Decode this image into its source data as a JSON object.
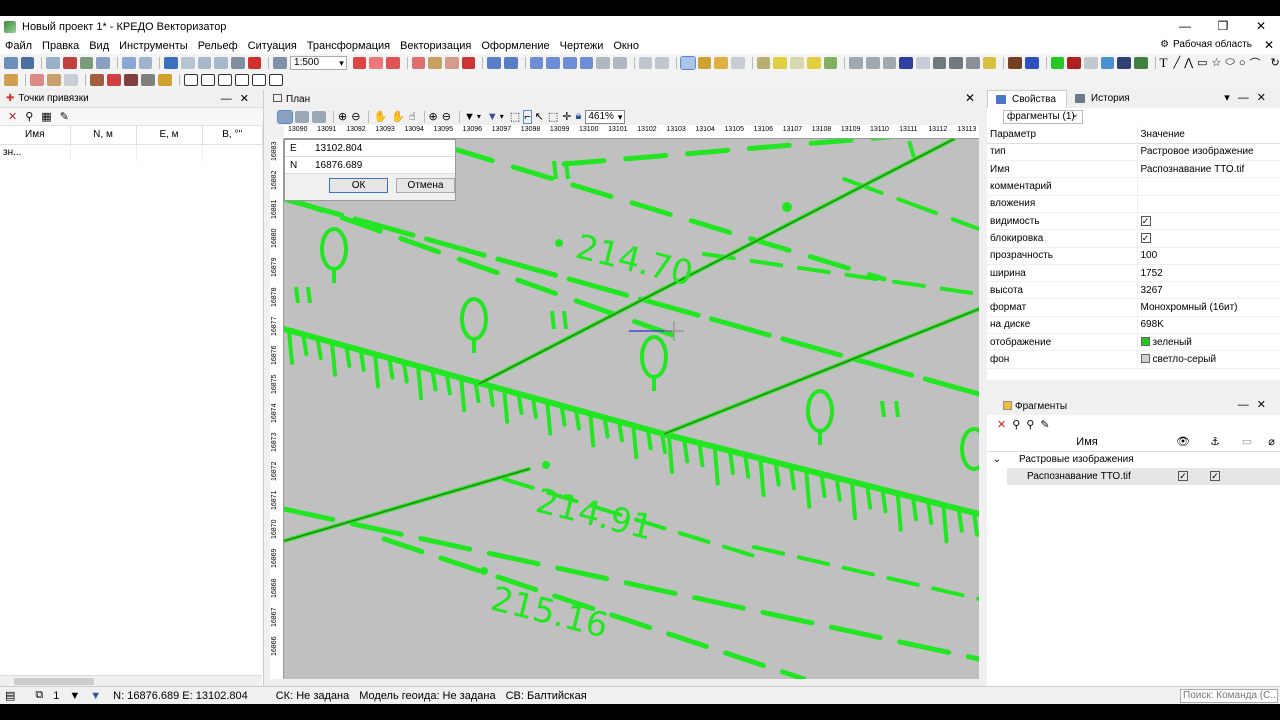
{
  "window": {
    "title": "Новый проект 1* - КРЕДО Векторизатор",
    "min_icon": "—",
    "max_icon": "❐",
    "close_icon": "✕"
  },
  "menu": [
    "Файл",
    "Правка",
    "Вид",
    "Инструменты",
    "Рельеф",
    "Ситуация",
    "Трансформация",
    "Векторизация",
    "Оформление",
    "Чертежи",
    "Окно"
  ],
  "workspace_label": "Рабочая область",
  "toolbar": {
    "scale_value": "1:500"
  },
  "left_panel": {
    "title": "Точки привязки",
    "columns": [
      "Имя",
      "N, м",
      "E, м",
      "B, °''"
    ],
    "rows": [
      {
        "name": "зн..."
      }
    ]
  },
  "plan": {
    "title": "План",
    "zoom": "461%",
    "ruler_x": [
      "13090",
      "13091",
      "13092",
      "13093",
      "13094",
      "13095",
      "13096",
      "13097",
      "13098",
      "13099",
      "13100",
      "13101",
      "13102",
      "13103",
      "13104",
      "13105",
      "13106",
      "13107",
      "13108",
      "13109",
      "13110",
      "13111",
      "13112",
      "13113"
    ],
    "ruler_y": [
      "16883",
      "16882",
      "16881",
      "16880",
      "16879",
      "16878",
      "16877",
      "16876",
      "16875",
      "16874",
      "16873",
      "16872",
      "16871",
      "16870",
      "16869",
      "16868",
      "16867",
      "16866"
    ],
    "labels": [
      "214.70",
      "214.91",
      "215.16"
    ],
    "coord_dialog": {
      "e_label": "E",
      "e_value": "13102.804",
      "n_label": "N",
      "n_value": "16876.689",
      "ok": "ОК",
      "cancel": "Отмена"
    }
  },
  "properties": {
    "tab_props": "Свойства",
    "tab_history": "История",
    "filter": "фрагменты (1)",
    "col_param": "Параметр",
    "col_value": "Значение",
    "rows": [
      {
        "param": "тип",
        "value": "Растровое изображение"
      },
      {
        "param": "Имя",
        "value": "Распознавание ТТО.tif"
      },
      {
        "param": "комментарий",
        "value": ""
      },
      {
        "param": "вложения",
        "value": ""
      },
      {
        "param": "видимость",
        "check": true
      },
      {
        "param": "блокировка",
        "check": true
      },
      {
        "param": "прозрачность",
        "value": "100"
      },
      {
        "param": "ширина",
        "value": "1752"
      },
      {
        "param": "высота",
        "value": "3267"
      },
      {
        "param": "формат",
        "value": "Монохромный (16ит)"
      },
      {
        "param": "на диске",
        "value": "698K"
      },
      {
        "param": "отображение",
        "value": "зеленый",
        "swatch": "#22c922"
      },
      {
        "param": "фон",
        "value": "светло-серый",
        "swatch": "#d0d0d0"
      }
    ]
  },
  "fragments": {
    "title": "Фрагменты",
    "col_name": "Имя",
    "group": "Растровые изображения",
    "item": "Распознавание ТТО.tif"
  },
  "status": {
    "count": "1",
    "coords": "N: 16876.689  E: 13102.804",
    "ck": "СК:  Не задана",
    "geoid": "Модель геоида:  Не задана",
    "heights": "СВ:  Балтийская",
    "command_placeholder": "Поиск: Команда (С..."
  },
  "colors": {
    "raster": "#22e622",
    "canvas_bg": "#c0c0c0",
    "accent": "#3a74c9"
  }
}
